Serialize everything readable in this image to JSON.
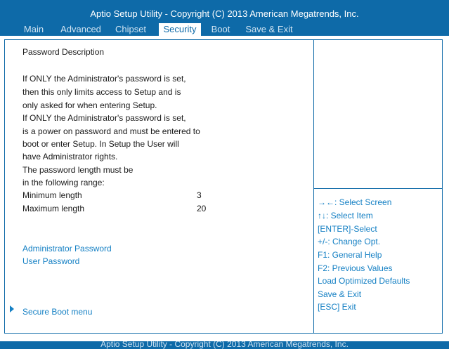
{
  "header": {
    "title": "Aptio Setup Utility - Copyright  (C)  2013 American Megatrends, Inc.",
    "tabs": [
      "Main",
      "Advanced",
      "Chipset",
      "Security",
      "Boot",
      "Save & Exit"
    ],
    "active_tab": "Security"
  },
  "main": {
    "section_title": "Password Description",
    "description": [
      "If ONLY the Administrator's password is set,",
      "then this only limits access to Setup and is",
      "only asked for when entering Setup.",
      "If ONLY the Administrator's password is set,",
      "is a power on password and must be entered to",
      "boot or enter Setup. In Setup the User will",
      "have Administrator rights.",
      "The password length must be",
      "in the following range:"
    ],
    "min_label": "Minimum length",
    "min_value": "3",
    "max_label": "Maximum length",
    "max_value": "20",
    "admin_password": "Administrator Password",
    "user_password": "User Password",
    "secure_boot": "Secure Boot menu"
  },
  "help": [
    "→←: Select Screen",
    "↑↓: Select Item",
    "[ENTER]-Select",
    "+/-: Change Opt.",
    "F1: General Help",
    "F2: Previous Values",
    "Load Optimized Defaults",
    "Save & Exit",
    "[ESC] Exit"
  ],
  "footer": {
    "title": "Aptio Setup Utility - Copyright  (C)  2013 American Megatrends, Inc."
  },
  "colors": {
    "bar": "#0e6aa8",
    "link": "#1580c4"
  }
}
